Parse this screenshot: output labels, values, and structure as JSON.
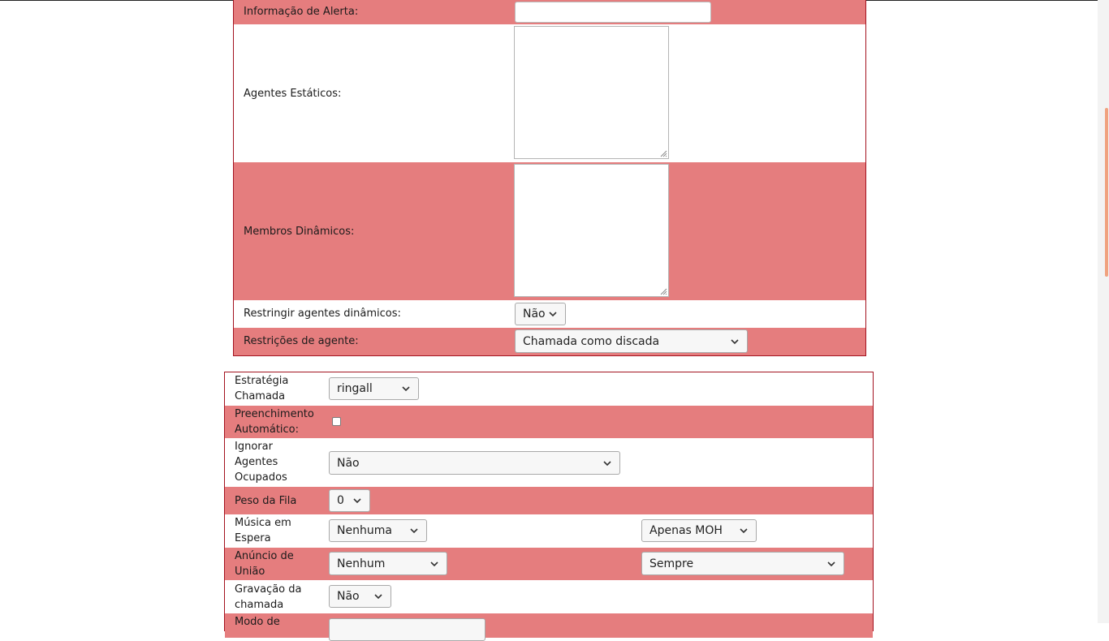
{
  "queue_settings": {
    "alert_info_label": "Informação de Alerta:",
    "alert_info_value": "",
    "static_agents_label": "Agentes Estáticos:",
    "static_agents_value": "",
    "dynamic_members_label": "Membros Dinâmicos:",
    "dynamic_members_value": "",
    "restrict_dynamic_label": "Restringir agentes dinâmicos:",
    "restrict_dynamic_value": "Não",
    "agent_restrictions_label": "Restrições de agente:",
    "agent_restrictions_value": "Chamada como discada"
  },
  "call_settings": {
    "strategy_label_1": "Estratégia",
    "strategy_label_2": "Chamada",
    "strategy_value": "ringall",
    "autofill_label_1": "Preenchimento",
    "autofill_label_2": "Automático:",
    "autofill_checked": false,
    "skip_busy_label_1": "Ignorar",
    "skip_busy_label_2": "Agentes",
    "skip_busy_label_3": "Ocupados",
    "skip_busy_value": "Não",
    "queue_weight_label": "Peso da Fila",
    "queue_weight_value": "0",
    "music_label_1": "Música em",
    "music_label_2": "Espera",
    "music_value": "Nenhuma",
    "music_mode_value": "Apenas MOH",
    "join_announce_label_1": "Anúncio de",
    "join_announce_label_2": "União",
    "join_announce_value": "Nenhum",
    "join_announce_mode_value": "Sempre",
    "recording_label_1": "Gravação da",
    "recording_label_2": "chamada",
    "recording_value": "Não",
    "mode_label_partial": "Modo de"
  },
  "icons": {
    "chevron": "chevron-down-icon",
    "resize": "resize-grip-icon"
  },
  "colors": {
    "row_pink": "#e57d7e",
    "border": "#a3121f",
    "scroll_thumb": "#f0a27f"
  }
}
